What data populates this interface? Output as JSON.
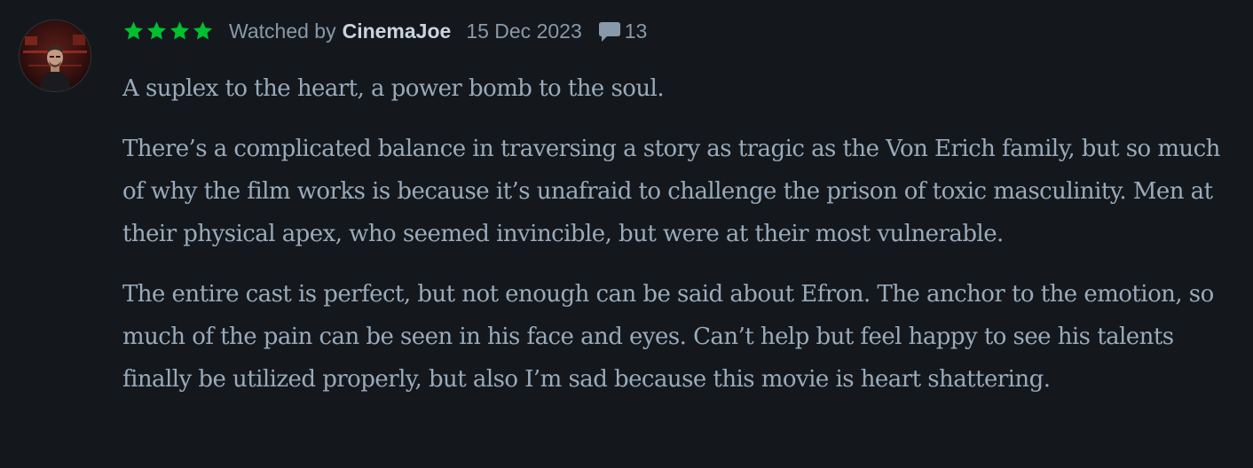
{
  "review": {
    "rating": 4,
    "rating_max": 5,
    "star_color": "#00c030",
    "watched_label": "Watched by",
    "username": "CinemaJoe",
    "date": "15 Dec 2023",
    "comment_count": "13",
    "paragraphs": [
      "A suplex to the heart, a power bomb to the soul.",
      "There’s a complicated balance in traversing a story as tragic as the Von Erich family, but so much of why the film works is because it’s unafraid to challenge the prison of toxic masculinity. Men at their physical apex, who seemed invincible, but were at their most vulnerable.",
      "The entire cast is perfect, but not enough can be said about Efron. The anchor to the emotion, so much of the pain can be seen in his face and eyes. Can’t help but feel happy to see his talents finally be utilized properly, but also I’m sad because this movie is heart shattering."
    ]
  },
  "icons": {
    "avatar": "avatar",
    "star": "star-icon",
    "comment": "speech-bubble-icon"
  }
}
